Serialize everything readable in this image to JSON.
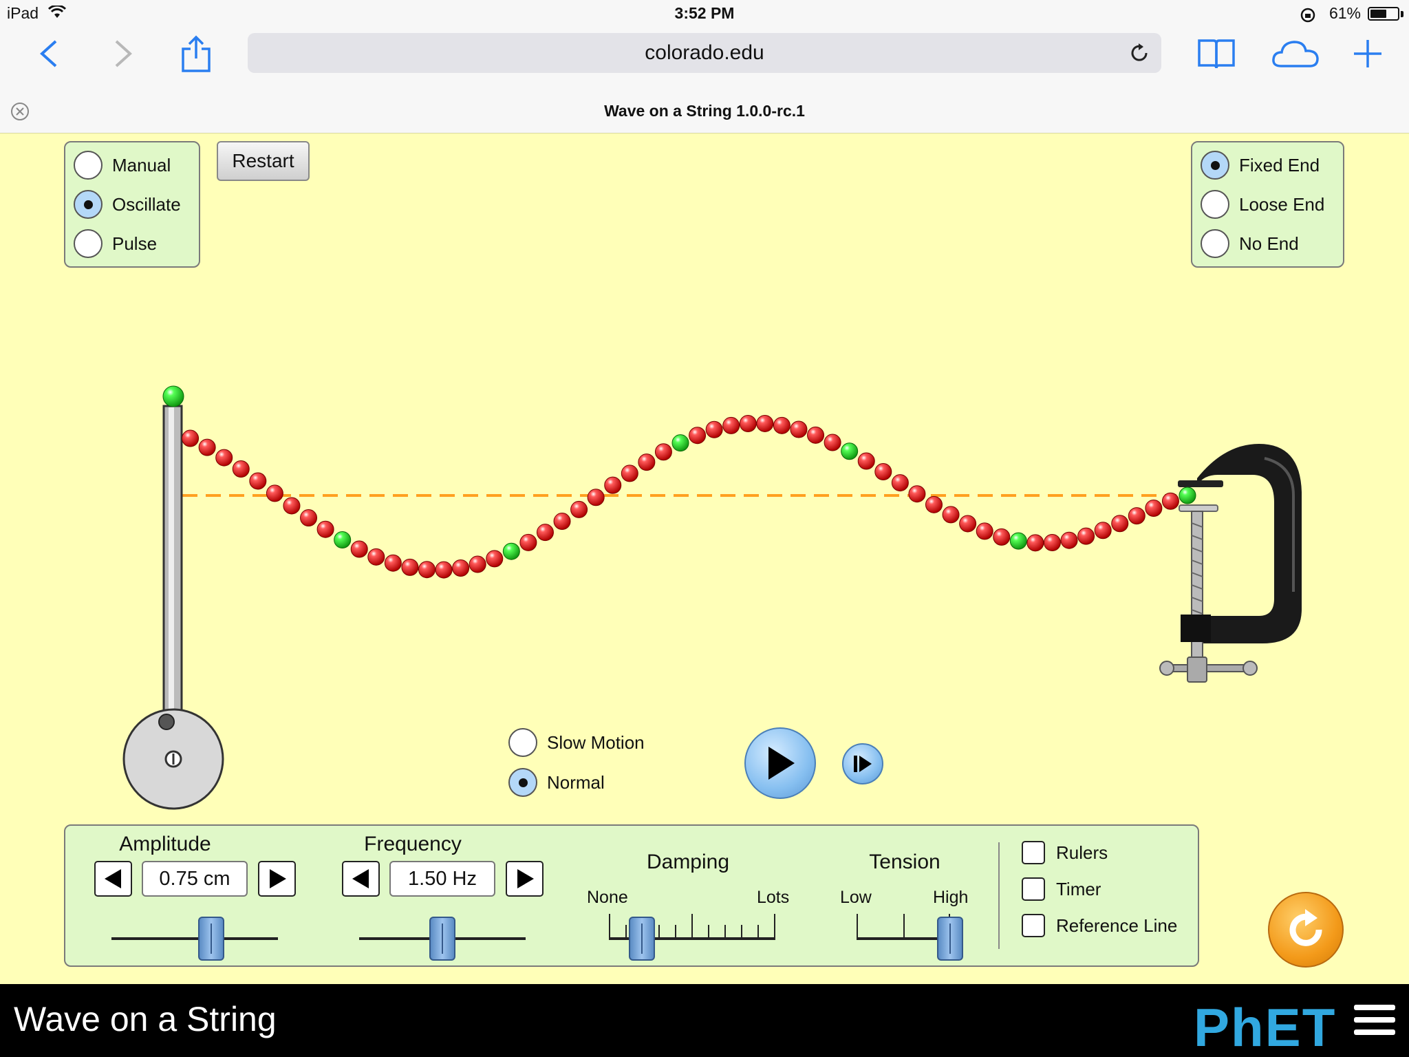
{
  "status_bar": {
    "carrier": "iPad",
    "time": "3:52 PM",
    "battery": "61%",
    "battery_level": 0.61
  },
  "browser": {
    "url": "colorado.edu",
    "tab_title": "Wave on a String 1.0.0-rc.1"
  },
  "mode_panel": {
    "options": [
      {
        "label": "Manual",
        "selected": false
      },
      {
        "label": "Oscillate",
        "selected": true
      },
      {
        "label": "Pulse",
        "selected": false
      }
    ]
  },
  "restart_label": "Restart",
  "end_panel": {
    "options": [
      {
        "label": "Fixed End",
        "selected": true
      },
      {
        "label": "Loose End",
        "selected": false
      },
      {
        "label": "No End",
        "selected": false
      }
    ]
  },
  "speed": {
    "options": [
      {
        "label": "Slow Motion",
        "selected": false
      },
      {
        "label": "Normal",
        "selected": true
      }
    ]
  },
  "controls": {
    "amplitude": {
      "title": "Amplitude",
      "value": "0.75 cm",
      "level": 0.6
    },
    "frequency": {
      "title": "Frequency",
      "value": "1.50 Hz",
      "level": 0.5
    },
    "damping": {
      "title": "Damping",
      "min_label": "None",
      "max_label": "Lots",
      "level": 0.2
    },
    "tension": {
      "title": "Tension",
      "min_label": "Low",
      "max_label": "High",
      "level": 1.0
    }
  },
  "checks": [
    {
      "label": "Rulers",
      "checked": false
    },
    {
      "label": "Timer",
      "checked": false
    },
    {
      "label": "Reference Line",
      "checked": false
    }
  ],
  "footer": {
    "title": "Wave on a String",
    "logo": "PhET"
  },
  "colors": {
    "background": "#ffffb8",
    "panel": "#e0f8c8",
    "bead": "#ee1111",
    "bead_marker": "#22dd22",
    "reference_line": "#ffa020"
  }
}
